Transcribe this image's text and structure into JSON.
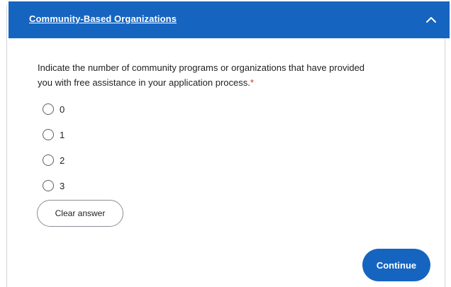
{
  "section": {
    "title": "Community-Based Organizations",
    "header_color": "#1565c0",
    "toggle_icon": "chevron-up-icon"
  },
  "question": {
    "text": "Indicate the number of community programs or organizations that have provided you with free assistance in your application process.",
    "required_marker": "*"
  },
  "options": [
    {
      "label": "0",
      "selected": false
    },
    {
      "label": "1",
      "selected": false
    },
    {
      "label": "2",
      "selected": false
    },
    {
      "label": "3",
      "selected": false
    }
  ],
  "buttons": {
    "clear_label": "Clear answer",
    "continue_label": "Continue"
  },
  "colors": {
    "accent": "#1565c0",
    "required": "#d32f2f"
  }
}
